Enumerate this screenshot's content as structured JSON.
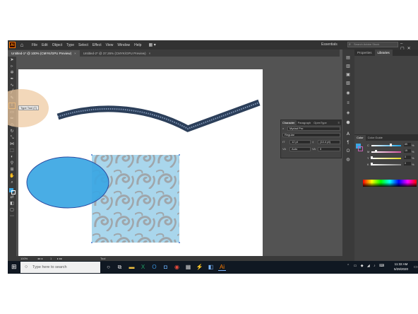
{
  "app": {
    "logo": "Ai",
    "menus": [
      "File",
      "Edit",
      "Object",
      "Type",
      "Select",
      "Effect",
      "View",
      "Window",
      "Help"
    ],
    "workspace": "Essentials",
    "search_placeholder": "Search Adobe Stock"
  },
  "tabs": [
    {
      "label": "Untitled-1* @ 100% (CMYK/GPU Preview)",
      "active": true
    },
    {
      "label": "Untitled-2* @ 37.26% (CMYK/GPU Preview)",
      "active": false
    }
  ],
  "tooltip": "Type Tool (T)",
  "character_panel": {
    "tabs": [
      "Character",
      "Paragraph",
      "OpenType"
    ],
    "font_family": "Myriad Pro",
    "font_style": "Regular",
    "font_size": "12 pt",
    "leading": "(14.4 pt)",
    "kerning": "Auto",
    "tracking": "0"
  },
  "right_panel": {
    "tabs": [
      "Properties",
      "Libraries"
    ]
  },
  "color_panel": {
    "tabs": [
      "Color",
      "Color Guide"
    ],
    "channels": [
      {
        "label": "C",
        "value": "65",
        "level": 0.65,
        "track": "#1aa3e6"
      },
      {
        "label": "M",
        "value": "15",
        "level": 0.15,
        "track": "#d44fa0"
      },
      {
        "label": "Y",
        "value": "0",
        "level": 0.0,
        "track": "#e3d826"
      },
      {
        "label": "K",
        "value": "0",
        "level": 0.0,
        "track": "#888888"
      }
    ],
    "unit": "%"
  },
  "status": {
    "zoom": "100%",
    "page": "1",
    "tool": "Tool"
  },
  "taskbar": {
    "search_placeholder": "Type here to search",
    "time": "11:32 AM",
    "date": "5/29/2020"
  },
  "colors": {
    "fill": "#3aa6e3",
    "accent": "#ff7c00",
    "pattern_base": "#a9d6ec",
    "pattern_swirl": "#9fa6ab",
    "ribbon": "#2c3f5a"
  }
}
